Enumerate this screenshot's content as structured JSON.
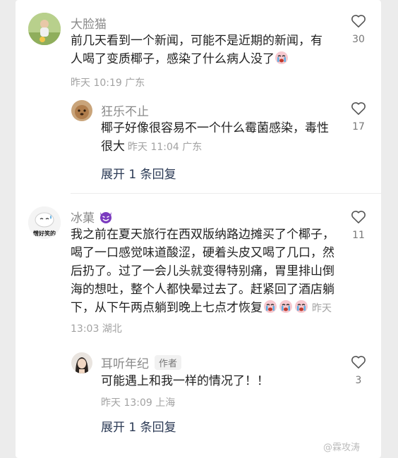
{
  "comments": [
    {
      "user": "大脸猫",
      "text": "前几天看到一个新闻，可能不是近期的新闻，有人喝了变质椰子，感染了什么病人没了",
      "meta": "昨天 10:19 广东",
      "likes": "30",
      "emoji": "crying-emoji"
    },
    {
      "user": "狂乐不止",
      "text": "椰子好像很容易不一个什么霉菌感染，毒性很大",
      "meta": "昨天 11:04 广东",
      "likes": "17"
    },
    {
      "user": "冰菓",
      "user_emoji": "smiling-devil-emoji",
      "avatar_text": "憎好笑的",
      "text": "我之前在夏天旅行在西双版纳路边摊买了个椰子，喝了一口感觉味道酸涩，硬着头皮又喝了几口，然后扔了。过了一会儿头就变得特别痛，胃里排山倒海的想吐，整个人都快晕过去了。赶紧回了酒店躺下，从下午两点躺到晚上七点才恢复",
      "meta": "昨天 13:03 湖北",
      "likes": "11",
      "emojis": [
        "crying-emoji",
        "crying-emoji",
        "crying-emoji"
      ]
    },
    {
      "user": "耳听年纪",
      "badge": "作者",
      "text": "可能遇上和我一样的情况了！！",
      "meta": "昨天 13:09 上海",
      "likes": "3"
    }
  ],
  "expand_replies": [
    "展开 1 条回复",
    "展开 1 条回复"
  ],
  "watermark": "@霖攻涛",
  "colors": {
    "devil": "#7b3bbf",
    "link": "#2b3a55",
    "meta": "#a2a2a2"
  }
}
